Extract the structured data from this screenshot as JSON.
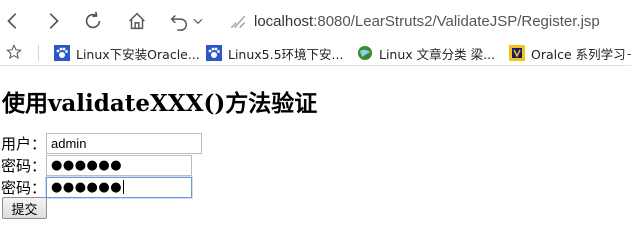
{
  "browser": {
    "url_host": "localhost",
    "url_rest": ":8080/LearStruts2/ValidateJSP/Register.jsp"
  },
  "bookmarks": [
    {
      "label": "Linux下安装Oracle...",
      "icon": "paw-icon",
      "color": "#2b57c8"
    },
    {
      "label": "Linux5.5环境下安...",
      "icon": "paw-icon",
      "color": "#2b57c8"
    },
    {
      "label": "Linux 文章分类 梁...",
      "icon": "globe-icon",
      "color": "#3a8c2c"
    },
    {
      "label": "Oralce 系列学习－",
      "icon": "book-icon",
      "color": "#f0c419"
    }
  ],
  "page": {
    "title": "使用validateXXX()方法验证",
    "username_label": "用户：",
    "username_value": "admin",
    "password_label": "密码：",
    "password_mask": "●●●●●●",
    "confirm_label": "密码：",
    "confirm_mask": "●●●●●●",
    "submit_label": "提交"
  }
}
